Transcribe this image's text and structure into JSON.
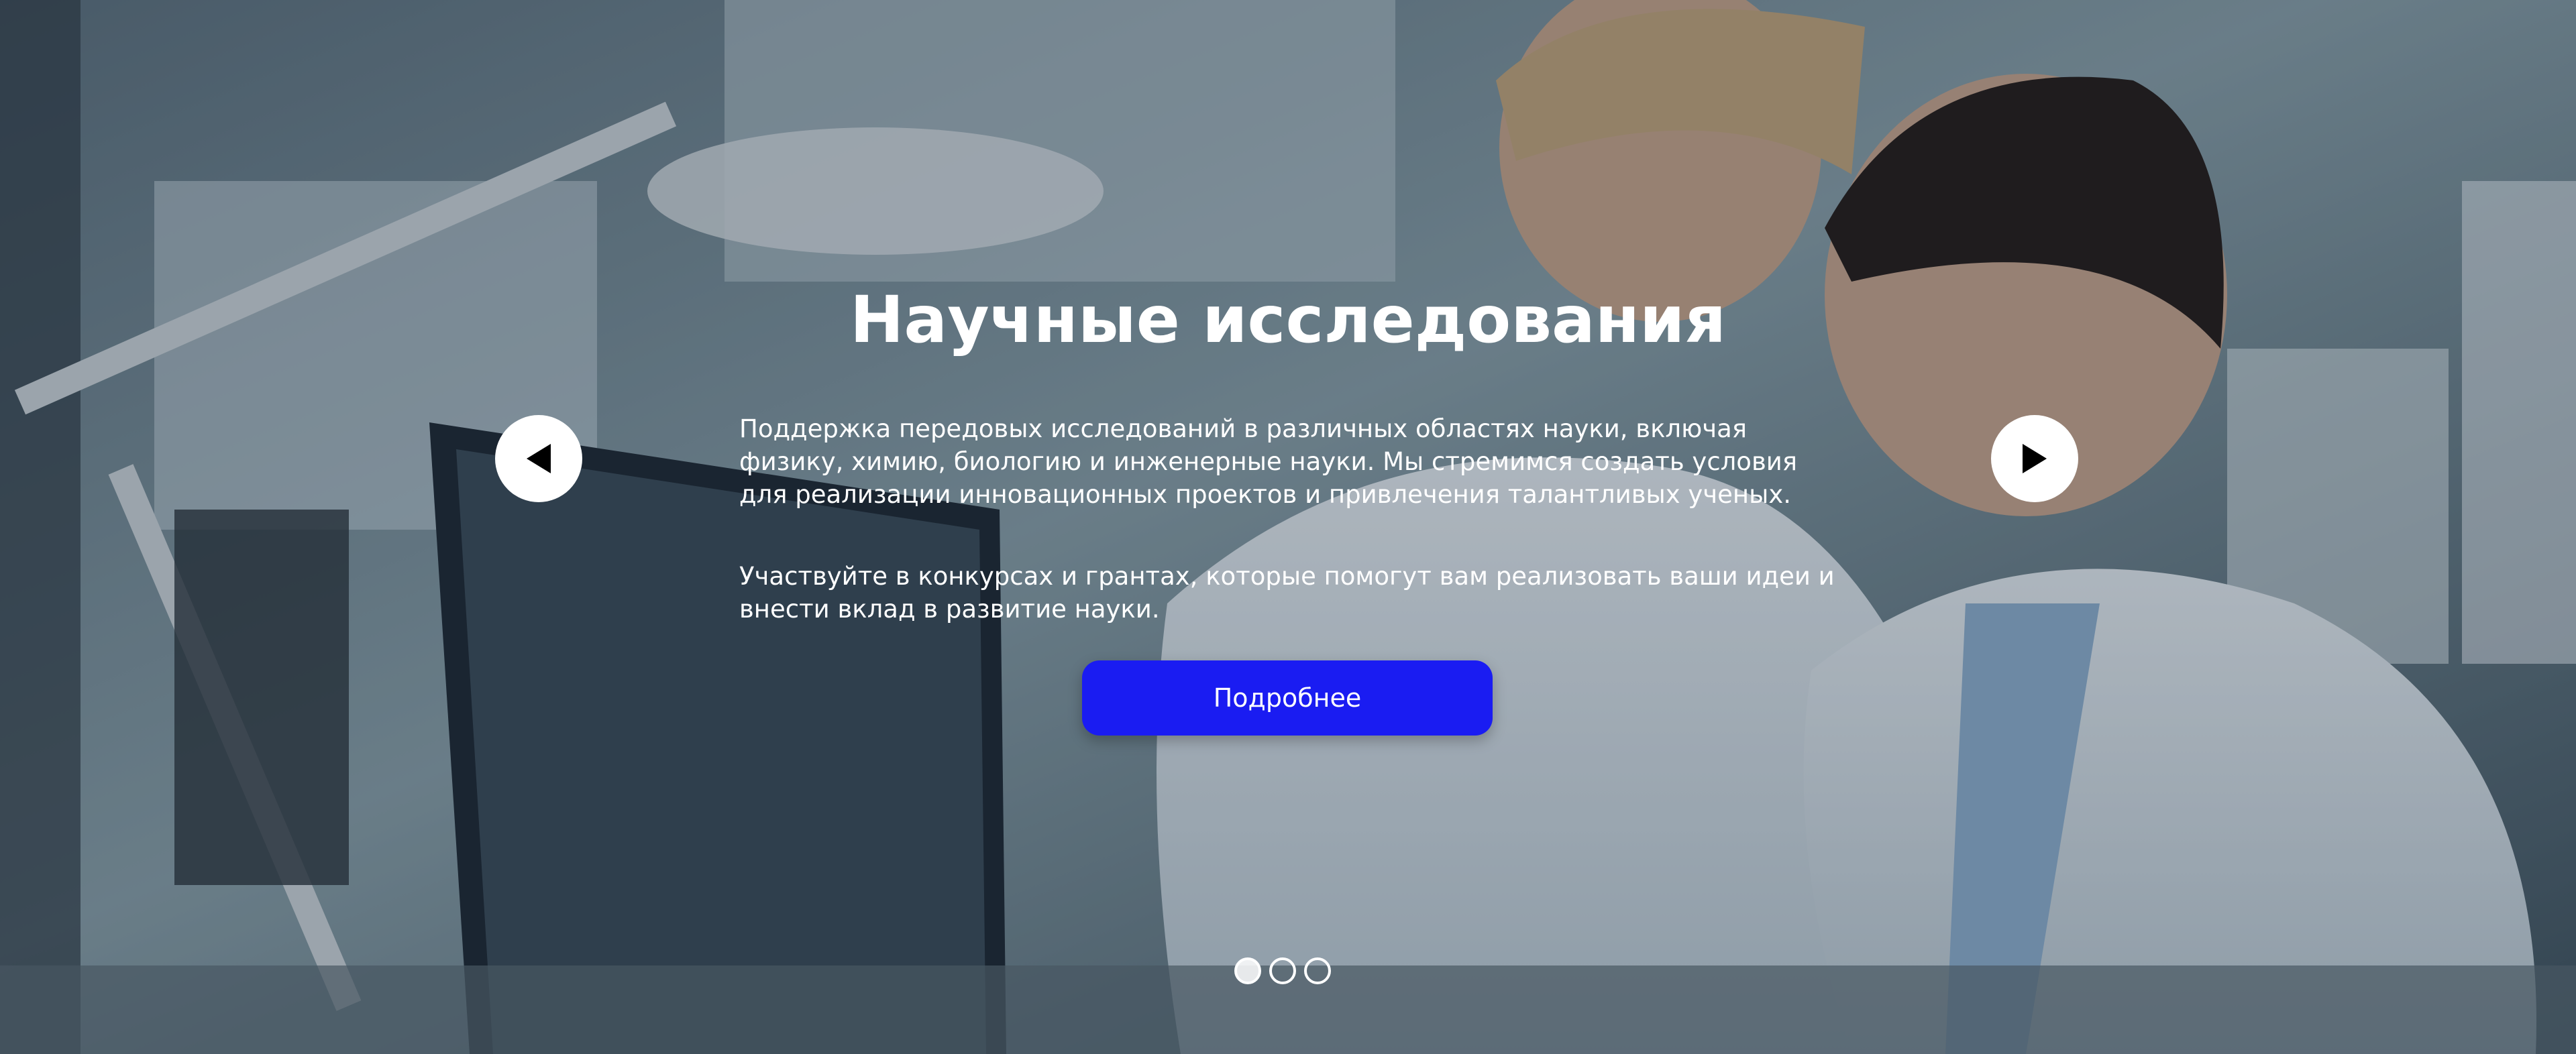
{
  "slide": {
    "title": "Научные исследования",
    "paragraph_1": "Поддержка передовых исследований в различных областях науки, включая физику, химию, биологию и инженерные науки. Мы стремимся создать условия для реализации инновационных проектов и привлечения талантливых ученых.",
    "paragraph_2": "Участвуйте в конкурсах и грантах, которые помогут вам реализовать ваши идеи и внести вклад в развитие науки.",
    "cta_label": "Подробнее"
  },
  "carousel": {
    "prev_icon": "triangle-left-icon",
    "next_icon": "triangle-right-icon",
    "slide_count": 3,
    "active_index": 0
  },
  "colors": {
    "accent": "#1a1cf2",
    "text": "#ffffff",
    "arrow_bg": "#ffffff",
    "arrow_icon": "#000000"
  }
}
